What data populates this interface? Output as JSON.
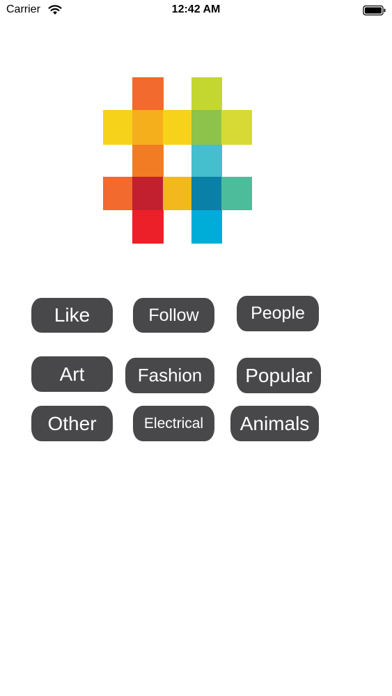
{
  "status_bar": {
    "carrier": "Carrier",
    "time": "12:42 AM",
    "wifi_icon": "wifi-icon",
    "battery_icon": "battery-icon"
  },
  "logo": {
    "icon": "hashtag-icon",
    "colors": {
      "orange": "#F26A2E",
      "yellow": "#F7D21B",
      "amber": "#F5AF1C",
      "lime": "#C4D731",
      "green": "#8DC34B",
      "yellow_green": "#D7DA34",
      "cyan": "#45BECD",
      "teal": "#4DBC9A",
      "deep_red": "#C2202E",
      "gold": "#F2B81E",
      "blue_teal": "#0B80A6",
      "red": "#EC2028",
      "blue": "#00ADD8",
      "orange2": "#F27C23"
    }
  },
  "tags": [
    {
      "label": "Like"
    },
    {
      "label": "Follow"
    },
    {
      "label": "People"
    },
    {
      "label": "Art"
    },
    {
      "label": "Fashion"
    },
    {
      "label": "Popular"
    },
    {
      "label": "Other"
    },
    {
      "label": "Electrical"
    },
    {
      "label": "Animals"
    }
  ]
}
